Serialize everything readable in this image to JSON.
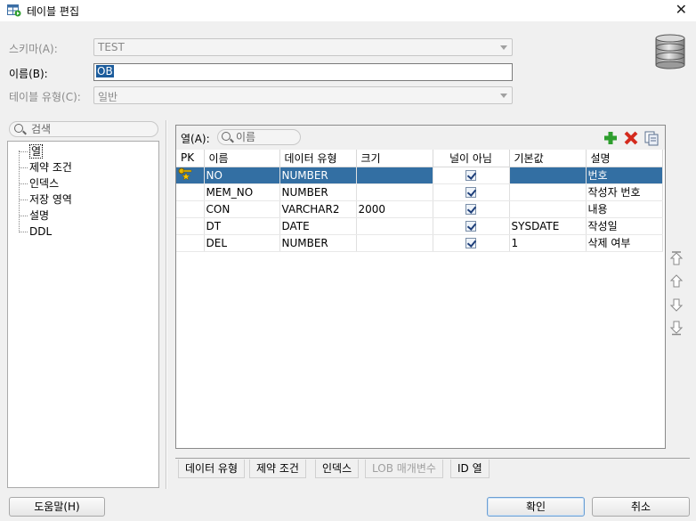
{
  "window": {
    "title": "테이블 편집",
    "close_glyph": "✕"
  },
  "form": {
    "schema_label": "스키마(A):",
    "schema_value": "TEST",
    "name_label": "이름(B):",
    "name_value": "OB",
    "type_label": "테이블 유형(C):",
    "type_value": "일반"
  },
  "left": {
    "search_placeholder": "검색",
    "tree": [
      "열",
      "제약 조건",
      "인덱스",
      "저장 영역",
      "설명",
      "DDL"
    ]
  },
  "columns_panel": {
    "label": "열(A):",
    "search_placeholder": "이름",
    "headers": [
      "PK",
      "이름",
      "데이터 유형",
      "크기",
      "널이 아님",
      "기본값",
      "설명"
    ],
    "rows": [
      {
        "pk": true,
        "name": "NO",
        "type": "NUMBER",
        "size": "",
        "not_null": true,
        "default": "",
        "comment": "번호"
      },
      {
        "pk": false,
        "name": "MEM_NO",
        "type": "NUMBER",
        "size": "",
        "not_null": true,
        "default": "",
        "comment": "작성자 번호"
      },
      {
        "pk": false,
        "name": "CON",
        "type": "VARCHAR2",
        "size": "2000",
        "not_null": true,
        "default": "",
        "comment": "내용"
      },
      {
        "pk": false,
        "name": "DT",
        "type": "DATE",
        "size": "",
        "not_null": true,
        "default": "SYSDATE",
        "comment": "작성일"
      },
      {
        "pk": false,
        "name": "DEL",
        "type": "NUMBER",
        "size": "",
        "not_null": true,
        "default": "1",
        "comment": "삭제 여부"
      }
    ]
  },
  "bottom_tabs": [
    "데이터 유형",
    "제약 조건",
    "인덱스",
    "LOB 매개변수",
    "ID 열"
  ],
  "buttons": {
    "help": "도움말(H)",
    "ok": "확인",
    "cancel": "취소"
  },
  "colors": {
    "selection": "#336fa3",
    "add": "#2e9e2e",
    "delete": "#d42b1e"
  }
}
